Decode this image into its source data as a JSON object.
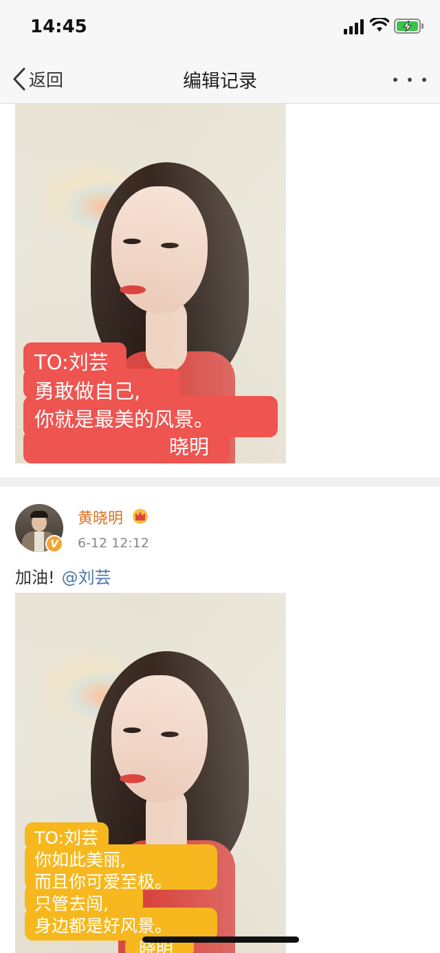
{
  "status": {
    "time": "14:45"
  },
  "nav": {
    "back_label": "返回",
    "title": "编辑记录"
  },
  "photo1": {
    "card_color": "#ee5450",
    "lines": [
      "TO:刘芸",
      "勇敢做自己,",
      "你就是最美的风景。",
      "晓明"
    ]
  },
  "post": {
    "author": "黄晓明",
    "time": "6-12 12:12",
    "text": "加油!",
    "mention": "@刘芸"
  },
  "photo2": {
    "card_color": "#f6b81e",
    "lines": [
      "TO:刘芸",
      "你如此美丽,",
      "而且你可爱至极。",
      "只管去闯,",
      "身边都是好风景。",
      "晓明"
    ]
  },
  "colors": {
    "username": "#e06f1f",
    "mention": "#4d76a6",
    "verified_badge": "#f2a531"
  }
}
